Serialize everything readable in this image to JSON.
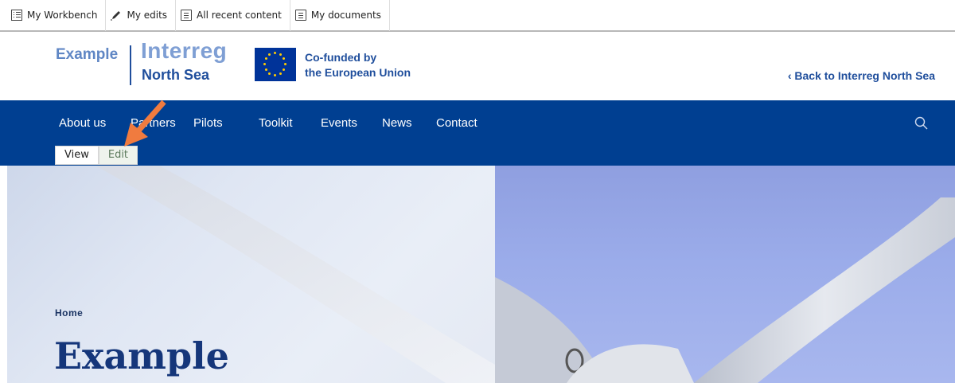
{
  "admin_toolbar": {
    "items": [
      {
        "label": "My Workbench",
        "icon": "workbench-icon"
      },
      {
        "label": "My edits",
        "icon": "pencil-icon"
      },
      {
        "label": "All recent content",
        "icon": "document-icon"
      },
      {
        "label": "My documents",
        "icon": "document-icon"
      }
    ]
  },
  "header": {
    "site_name": "Example",
    "logo_line1": "Interreg",
    "logo_line2": "North Sea",
    "eu_line1": "Co-funded by",
    "eu_line2": "the European Union",
    "back_link": "‹ Back to Interreg North Sea"
  },
  "nav": {
    "items": [
      "About us",
      "Partners",
      "Pilots",
      "Toolkit",
      "Events",
      "News",
      "Contact"
    ],
    "search_icon": "search-icon"
  },
  "tabs": {
    "view": "View",
    "edit": "Edit"
  },
  "hero": {
    "breadcrumb": "Home",
    "title": "Example"
  },
  "colors": {
    "brand_blue": "#003f91",
    "logo_light_blue": "#7f9fd4",
    "eu_blue": "#003399",
    "eu_gold": "#ffcc00",
    "annotation_arrow": "#f07b3f"
  }
}
